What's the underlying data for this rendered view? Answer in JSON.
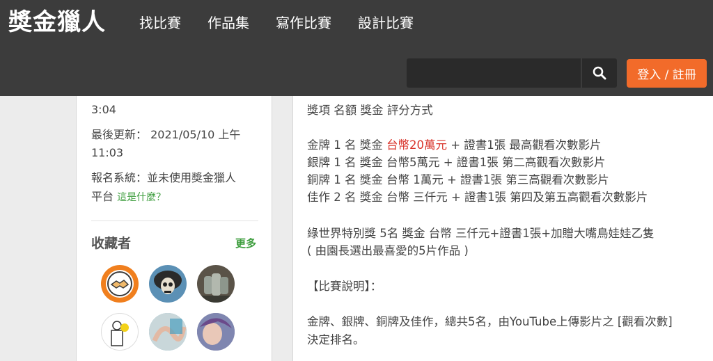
{
  "header": {
    "logo": "獎金獵人",
    "nav": [
      "找比賽",
      "作品集",
      "寫作比賽",
      "設計比賽"
    ],
    "search": {
      "value": "",
      "placeholder": ""
    },
    "login_label": "登入 / 註冊",
    "accent_color": "#f26b2a"
  },
  "sidebar": {
    "time_tail": "3:04",
    "last_updated_label": "最後更新：",
    "last_updated_date": "2021/05/10 上午",
    "last_updated_time": "11:03",
    "signup_label": "報名系統：並未使用獎金獵人",
    "signup_tail": "平台",
    "what_link": "這是什麼？",
    "collectors_title": "收藏者",
    "more_link": "更多",
    "avatars": [
      "handshake-avatar",
      "skull-avatar",
      "moai-avatar",
      "sketch-avatar",
      "hands-avatar",
      "anime-avatar"
    ]
  },
  "content": {
    "table_header": "獎項 名額 獎金 評分方式",
    "gold_pre": "金牌 1 名 獎金 ",
    "gold_amount": "台幣20萬元",
    "gold_post": " + 證書1張 最高觀看次數影片",
    "silver": "銀牌 1 名 獎金 台幣5萬元 + 證書1張 第二高觀看次數影片",
    "bronze": "銅牌 1 名 獎金 台幣 1萬元 + 證書1張 第三高觀看次數影片",
    "merit": "佳作 2 名 獎金 台幣 三仟元 + 證書1張 第四及第五高觀看次數影片",
    "green_prize": "綠世界特別獎 5名 獎金 台幣 三仟元+證書1張+加贈大嘴鳥娃娃乙隻",
    "green_note": "( 由園長選出最喜愛的5片作品 )",
    "section_title": "【比賽說明】：",
    "desc_line1": "金牌、銀牌、銅牌及佳作，總共5名，由YouTube上傳影片之 [觀看次數]",
    "desc_line2": "決定排名。"
  }
}
